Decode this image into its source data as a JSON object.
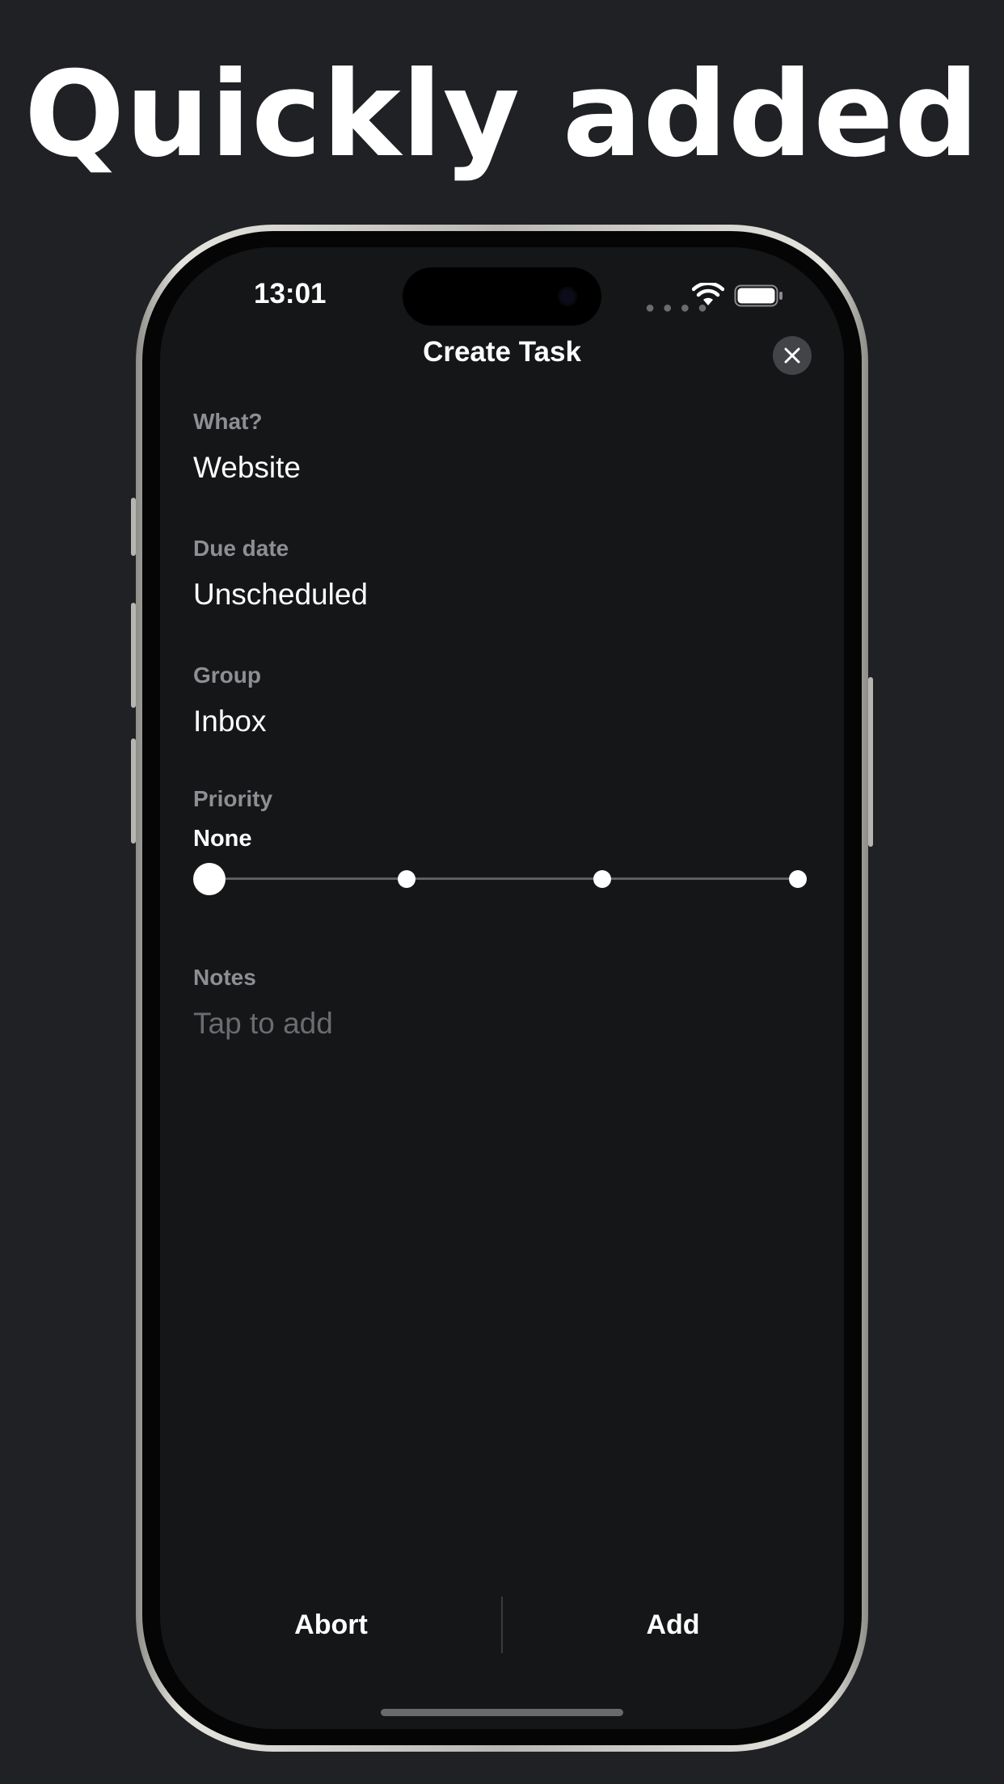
{
  "headline": "Quickly added",
  "status_bar": {
    "time": "13:01",
    "icons": [
      "signal-dots-icon",
      "wifi-icon",
      "battery-icon"
    ]
  },
  "sheet": {
    "title": "Create Task",
    "close_icon": "close-icon",
    "fields": {
      "what": {
        "label": "What?",
        "value": "Website"
      },
      "due_date": {
        "label": "Due date",
        "value": "Unscheduled"
      },
      "group": {
        "label": "Group",
        "value": "Inbox"
      },
      "priority": {
        "label": "Priority",
        "value": "None",
        "level_index": 0,
        "levels_count": 4
      },
      "notes": {
        "label": "Notes",
        "placeholder": "Tap to add"
      }
    },
    "actions": {
      "abort_label": "Abort",
      "add_label": "Add"
    }
  },
  "colors": {
    "background": "#202125",
    "screen": "#151618",
    "label": "#8e8e93",
    "text": "#ffffff",
    "placeholder": "#6b6b70"
  }
}
